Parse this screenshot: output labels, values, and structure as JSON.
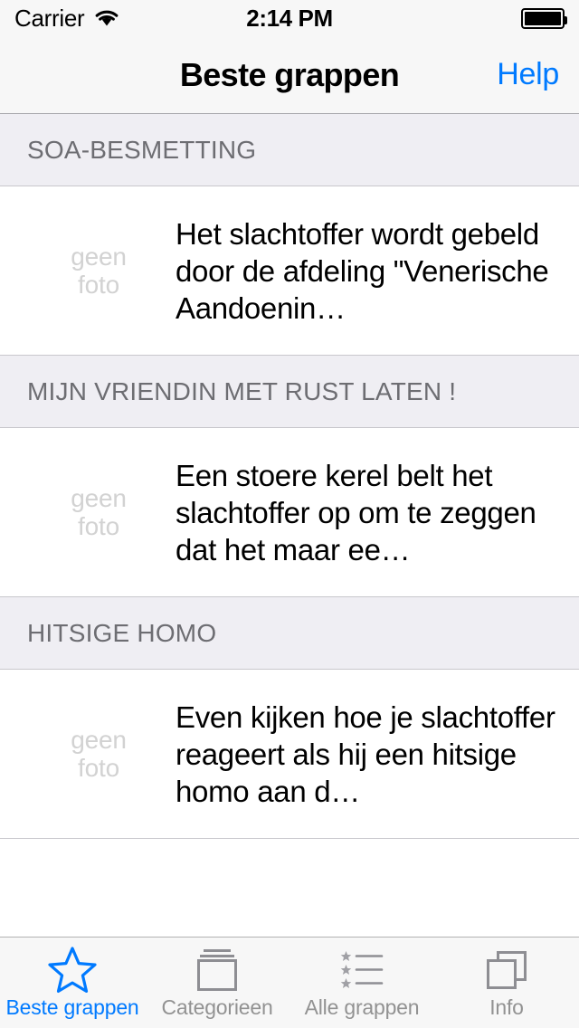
{
  "status_bar": {
    "carrier": "Carrier",
    "wifi_icon": "wifi-icon",
    "time": "2:14 PM",
    "battery_icon": "battery-full-icon"
  },
  "nav_bar": {
    "title": "Beste grappen",
    "right_button": "Help"
  },
  "colors": {
    "accent": "#007AFF",
    "nav_background": "#F7F7F7",
    "section_header_background": "#EFEEF3",
    "section_header_text": "#6D6D72",
    "separator": "#C8C7CC",
    "tab_inactive": "#929292",
    "placeholder_text": "#D2D2D2"
  },
  "list": {
    "thumb_placeholder_line1": "geen",
    "thumb_placeholder_line2": "foto",
    "sections": [
      {
        "header": "SOA-BESMETTING",
        "item_text": "Het slachtoffer wordt gebeld door de afdeling \"Venerische Aandoenin…"
      },
      {
        "header": "MIJN VRIENDIN MET RUST LATEN !",
        "item_text": "Een stoere kerel belt het slachtoffer op om te zeggen dat het maar ee…"
      },
      {
        "header": "HITSIGE HOMO",
        "item_text": "Even kijken hoe je slachtoffer reageert als hij een hitsige homo aan d…"
      }
    ]
  },
  "tab_bar": {
    "items": [
      {
        "label": "Beste grappen",
        "icon": "star-outline-icon",
        "selected": true
      },
      {
        "label": "Categorieen",
        "icon": "stacked-documents-icon",
        "selected": false
      },
      {
        "label": "Alle grappen",
        "icon": "starred-list-icon",
        "selected": false
      },
      {
        "label": "Info",
        "icon": "two-pages-icon",
        "selected": false
      }
    ]
  }
}
